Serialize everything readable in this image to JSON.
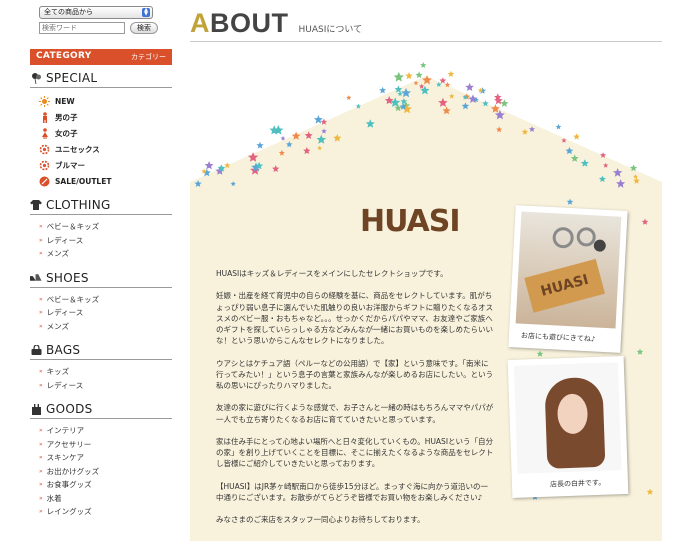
{
  "search": {
    "category_select": "全ての商品から",
    "placeholder": "検索ワード",
    "button_label": "検索"
  },
  "category_header": {
    "en": "CATEGORY",
    "ja": "カテゴリー"
  },
  "special": {
    "title": "SPECIAL",
    "items": [
      {
        "label": "NEW",
        "icon": "sun-icon"
      },
      {
        "label": "男の子",
        "icon": "boy-icon"
      },
      {
        "label": "女の子",
        "icon": "girl-icon"
      },
      {
        "label": "ユニセックス",
        "icon": "flower-icon"
      },
      {
        "label": "ブルマー",
        "icon": "flower-icon"
      },
      {
        "label": "SALE/OUTLET",
        "icon": "sale-icon"
      }
    ]
  },
  "clothing": {
    "title": "CLOTHING",
    "items": [
      "ベビー＆キッズ",
      "レディース",
      "メンズ"
    ]
  },
  "shoes": {
    "title": "SHOES",
    "items": [
      "ベビー＆キッズ",
      "レディース",
      "メンズ"
    ]
  },
  "bags": {
    "title": "BAGS",
    "items": [
      "キッズ",
      "レディース"
    ]
  },
  "goods": {
    "title": "GOODS",
    "items": [
      "インテリア",
      "アクセサリー",
      "スキンケア",
      "お出かけグッズ",
      "お食事グッズ",
      "水着",
      "レイングッズ"
    ]
  },
  "page": {
    "title_first": "A",
    "title_rest": "BOUT",
    "subtitle": "HUASIについて"
  },
  "logo": "HUASI",
  "paragraphs": [
    "HUASIはキッズ＆レディースをメインにしたセレクトショップです。",
    "妊娠・出産を経て育児中の自らの経験を基に、商品をセレクトしています。肌がちょっぴり弱い息子に選んでいた肌触りの良いお洋服からギフトに贈りたくなるオススメのベビー服・おもちゃなど。。。せっかくだからパパやママ、お友達やご家族へのギフトを探していらっしゃる方などみんなが一緒にお買いものを楽しめたらいいな！という思いからこんなセレクトになりました。",
    "ウアシとはケチュア語（ペルーなどの公用語）で【家】という意味です。「南米に行ってみたい！」という息子の言葉と家族みんなが楽しめるお店にしたい。という私の思いにぴったりハマりました。",
    "友達の家に遊びに行くような感覚で、お子さんと一緒の時はもちろんママやパパが一人でも立ち寄りたくなるお店に育てていきたいと思っています。",
    "家は住み手にとって心地よい場所へと日々変化していくもの。HUASIという「自分の家」を創り上げていくことを目標に、そこに揃えたくなるような商品をセレクトし皆様にご紹介していきたいと思っております。",
    "【HUASI】はJR茅ヶ崎駅南口から徒歩15分ほど。まっすぐ海に向かう道沿いの一中通りにございます。お散歩がてらどうぞ皆様でお買い物をお楽しみください♪",
    "みなさまのご来店をスタッフ一同心よりお待ちしております。"
  ],
  "photos": {
    "shop_caption": "お店にも遊びにきてね♪",
    "owner_caption": "店長の白井です。"
  },
  "colors": {
    "accent": "#d9502a",
    "title_gold": "#c0a33a",
    "house_cream": "#f8f2dc",
    "logo_brown": "#6e4424"
  }
}
